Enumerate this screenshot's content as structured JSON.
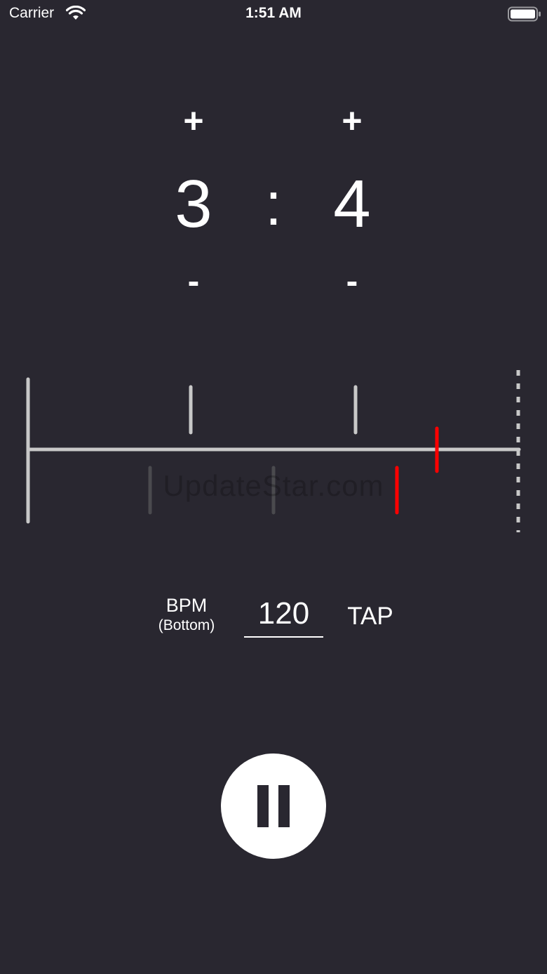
{
  "status_bar": {
    "carrier": "Carrier",
    "time": "1:51 AM"
  },
  "ratio": {
    "top_value": "3",
    "bottom_value": "4",
    "separator": ":",
    "increment_label": "+",
    "decrement_label": "-"
  },
  "timeline": {
    "playhead_color": "#ff0000",
    "tick_color": "#c8c8c8",
    "dim_tick_color": "#4a4a4e"
  },
  "watermark": "UpdateStar.com",
  "bpm": {
    "label": "BPM",
    "sublabel": "(Bottom)",
    "value": "120",
    "tap_label": "TAP"
  },
  "play_button": {
    "icon": "pause-icon"
  },
  "colors": {
    "background": "#292730",
    "foreground": "#ffffff"
  }
}
